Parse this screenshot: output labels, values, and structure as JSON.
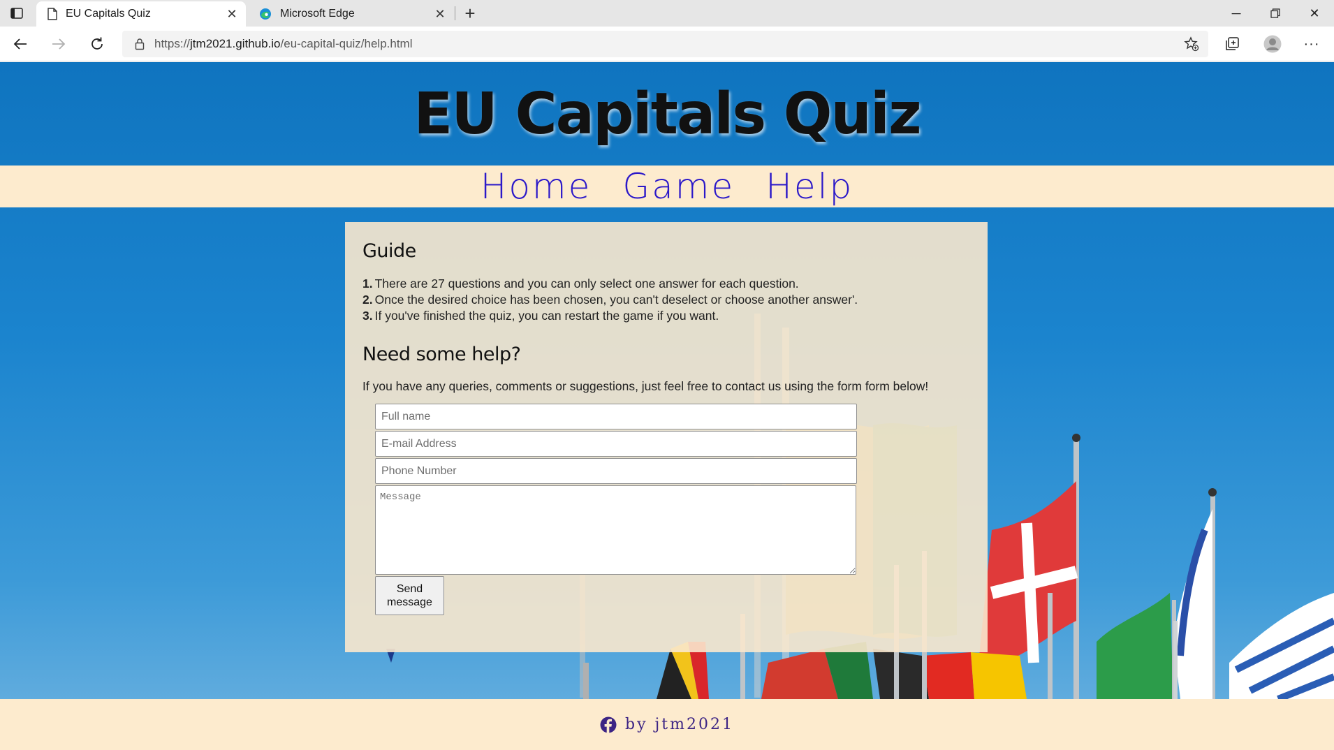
{
  "browser": {
    "tabs": [
      {
        "title": "EU Capitals Quiz",
        "active": true,
        "icon": "page-icon"
      },
      {
        "title": "Microsoft Edge",
        "active": false,
        "icon": "edge-logo-icon"
      }
    ],
    "address": {
      "scheme": "https://",
      "host": "jtm2021.github.io",
      "path": "/eu-capital-quiz/help.html"
    }
  },
  "site": {
    "title": "EU Capitals Quiz",
    "nav": [
      {
        "label": "Home"
      },
      {
        "label": "Game"
      },
      {
        "label": "Help"
      }
    ],
    "guide": {
      "heading": "Guide",
      "items": [
        {
          "num": "1.",
          "text": "There are 27 questions and you can only select one answer for each question."
        },
        {
          "num": "2.",
          "text": "Once the desired choice has been chosen, you can't deselect or choose another answer'."
        },
        {
          "num": "3.",
          "text": "If you've finished the quiz, you can restart the game if you want."
        }
      ]
    },
    "help": {
      "heading": "Need some help?",
      "text": "If you have any queries, comments or suggestions, just feel free to contact us using the form form below!"
    },
    "form": {
      "name_placeholder": "Full name",
      "email_placeholder": "E-mail Address",
      "phone_placeholder": "Phone Number",
      "message_placeholder": "Message",
      "send_label_line1": "Send",
      "send_label_line2": "message"
    },
    "footer": {
      "text": "by jtm2021",
      "icon": "facebook-icon"
    }
  },
  "colors": {
    "sky": "#1b84ce",
    "nav_bg": "#fdebce",
    "nav_link": "#2b18c9",
    "card_bg": "#fae8cd",
    "footer_text": "#3c2484"
  }
}
